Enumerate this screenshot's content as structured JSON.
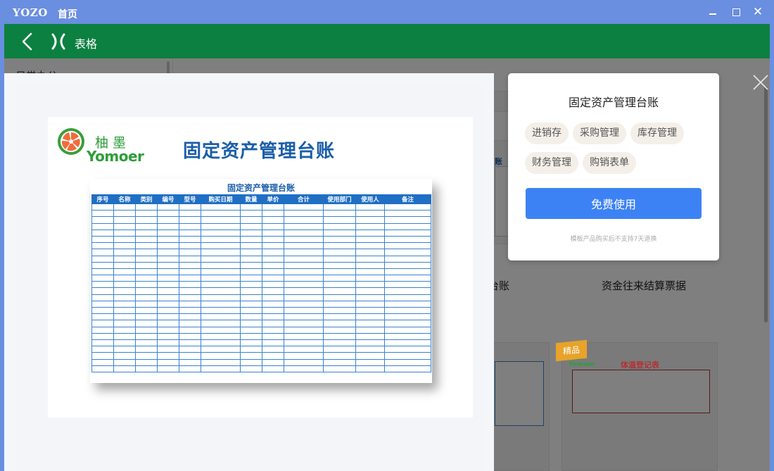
{
  "app": {
    "logo": "YOZO",
    "home_label": "首页"
  },
  "header": {
    "title": "表格"
  },
  "background": {
    "sidebar_item": "日常办公",
    "card_label_left": "台账",
    "card_label_right": "资金往来结算票据",
    "card_badge": "精品",
    "tile_title": "体温登记表",
    "tile_logo_cn": "柚墨",
    "tile_logo_en": "Yomoer",
    "partial_word": "账"
  },
  "preview": {
    "brand_cn": "柚墨",
    "brand_en": "Yomoer",
    "sheet_title": "固定资产管理台账",
    "table_title": "固定资产管理台账",
    "columns": [
      "序号",
      "名称",
      "类别",
      "编号",
      "型号",
      "购买日期",
      "数量",
      "单价",
      "合计",
      "使用部门",
      "使用人",
      "备注"
    ],
    "row_count": 26
  },
  "info": {
    "title": "固定资产管理台账",
    "tags": [
      "进销存",
      "采购管理",
      "库存管理",
      "财务管理",
      "购销表单"
    ],
    "free_button": "免费使用",
    "note": "模板产品购买后不支持7天退换"
  },
  "colors": {
    "header_green": "#0c8040",
    "titlebar_blue": "#6a8ee0",
    "button_blue": "#3d82f4",
    "table_blue": "#1f6fc5"
  },
  "icons": [
    "back-arrow-icon",
    "app-x-icon",
    "minimize-icon",
    "maximize-icon",
    "close-icon",
    "modal-close-icon"
  ]
}
